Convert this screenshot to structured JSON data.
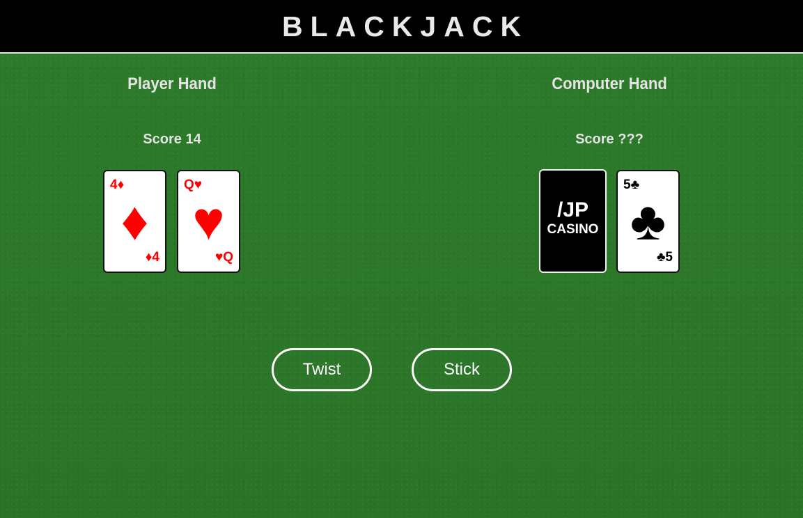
{
  "header": {
    "title": "BLACKJACK"
  },
  "player": {
    "title": "Player Hand",
    "score": "Score 14",
    "cards": [
      {
        "rank": "4",
        "suit": "♦",
        "suit_name": "diamonds",
        "color": "#ff0000"
      },
      {
        "rank": "Q",
        "suit": "♥",
        "suit_name": "hearts",
        "color": "#ff0000"
      }
    ]
  },
  "computer": {
    "title": "Computer Hand",
    "score": "Score ???",
    "back_card": {
      "logo_line1": "/JP",
      "logo_line2": "CASINO"
    },
    "cards": [
      {
        "rank": "5",
        "suit": "♣",
        "suit_name": "clubs",
        "color": "#000000"
      }
    ]
  },
  "actions": {
    "twist_label": "Twist",
    "stick_label": "Stick"
  },
  "colors": {
    "table_green": "#2b7628",
    "header_bg": "#000000",
    "card_red": "#ff0000"
  }
}
